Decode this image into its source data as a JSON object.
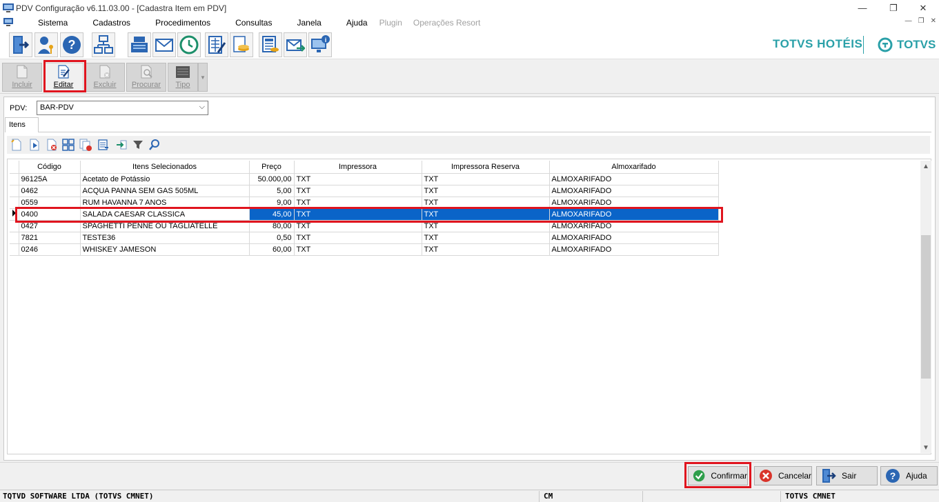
{
  "window": {
    "title": "PDV Configuração v6.11.03.00 - [Cadastra Item em PDV]",
    "minimize": "—",
    "restore": "❐",
    "close": "✕"
  },
  "menu": {
    "items": [
      "Sistema",
      "Cadastros",
      "Procedimentos",
      "Consultas",
      "Janela",
      "Ajuda"
    ],
    "disabled_items": [
      "Plugin",
      "Operações Resort"
    ],
    "mdi_controls": [
      "—",
      "❐",
      "✕"
    ]
  },
  "brand": {
    "hoteis": "TOTVS HOTÉIS",
    "totvs": "TOTVS",
    "color": "#2aa0a8"
  },
  "actions": {
    "incluir": "Incluir",
    "editar": "Editar",
    "excluir": "Excluir",
    "procurar": "Procurar",
    "tipo": "Tipo"
  },
  "filter": {
    "pdv_label": "PDV:",
    "pdv_value": "BAR-PDV"
  },
  "tabs": {
    "itens": "Itens"
  },
  "grid": {
    "columns": [
      "Código",
      "Itens Selecionados",
      "Preço",
      "Impressora",
      "Impressora Reserva",
      "Almoxarifado"
    ],
    "rows": [
      {
        "codigo": "96125A",
        "item": "Acetato de Potássio",
        "preco": "50.000,00",
        "impressora": "TXT",
        "reserva": "TXT",
        "almox": "ALMOXARIFADO"
      },
      {
        "codigo": "0462",
        "item": "ACQUA PANNA SEM GAS 505ML",
        "preco": "5,00",
        "impressora": "TXT",
        "reserva": "TXT",
        "almox": "ALMOXARIFADO"
      },
      {
        "codigo": "0559",
        "item": "RUM HAVANNA 7 ANOS",
        "preco": "9,00",
        "impressora": "TXT",
        "reserva": "TXT",
        "almox": "ALMOXARIFADO"
      },
      {
        "codigo": "0400",
        "item": "SALADA CAESAR CLASSICA",
        "preco": "45,00",
        "impressora": "TXT",
        "reserva": "TXT",
        "almox": "ALMOXARIFADO"
      },
      {
        "codigo": "0427",
        "item": "SPAGHETTI PENNE OU TAGLIATELLE",
        "preco": "80,00",
        "impressora": "TXT",
        "reserva": "TXT",
        "almox": "ALMOXARIFADO"
      },
      {
        "codigo": "7821",
        "item": "TESTE36",
        "preco": "0,50",
        "impressora": "TXT",
        "reserva": "TXT",
        "almox": "ALMOXARIFADO"
      },
      {
        "codigo": "0246",
        "item": "WHISKEY JAMESON",
        "preco": "60,00",
        "impressora": "TXT",
        "reserva": "TXT",
        "almox": "ALMOXARIFADO"
      }
    ],
    "selected_row": 3,
    "selection_color": "#0a64c8"
  },
  "buttons": {
    "confirmar": "Confirmar",
    "cancelar": "Cancelar",
    "sair": "Sair",
    "ajuda": "Ajuda"
  },
  "status": {
    "company": "TQTVD SOFTWARE LTDA (TOTVS CMNET)",
    "code": "CM",
    "product": "TOTVS CMNET"
  },
  "highlight_color": "#e0141e"
}
